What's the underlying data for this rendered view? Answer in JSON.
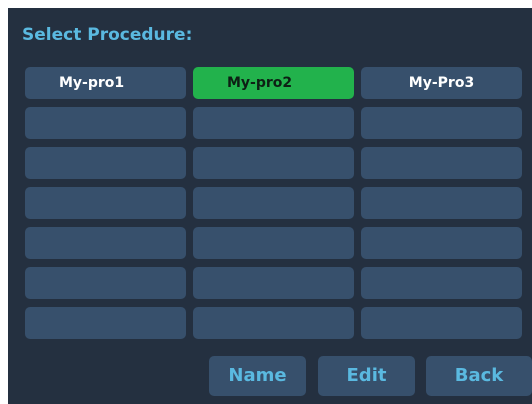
{
  "header": {
    "title": "Select Procedure:"
  },
  "procedures": {
    "selected_index": 1,
    "cells": [
      "My-pro1",
      "My-pro2",
      "My-Pro3",
      "",
      "",
      "",
      "",
      "",
      "",
      "",
      "",
      "",
      "",
      "",
      "",
      "",
      "",
      "",
      "",
      "",
      ""
    ]
  },
  "footer": {
    "name_label": "Name",
    "edit_label": "Edit",
    "back_label": "Back"
  },
  "colors": {
    "background": "#243040",
    "cell": "#37506c",
    "selected": "#22b24c",
    "accent_text": "#5ab9e0"
  }
}
